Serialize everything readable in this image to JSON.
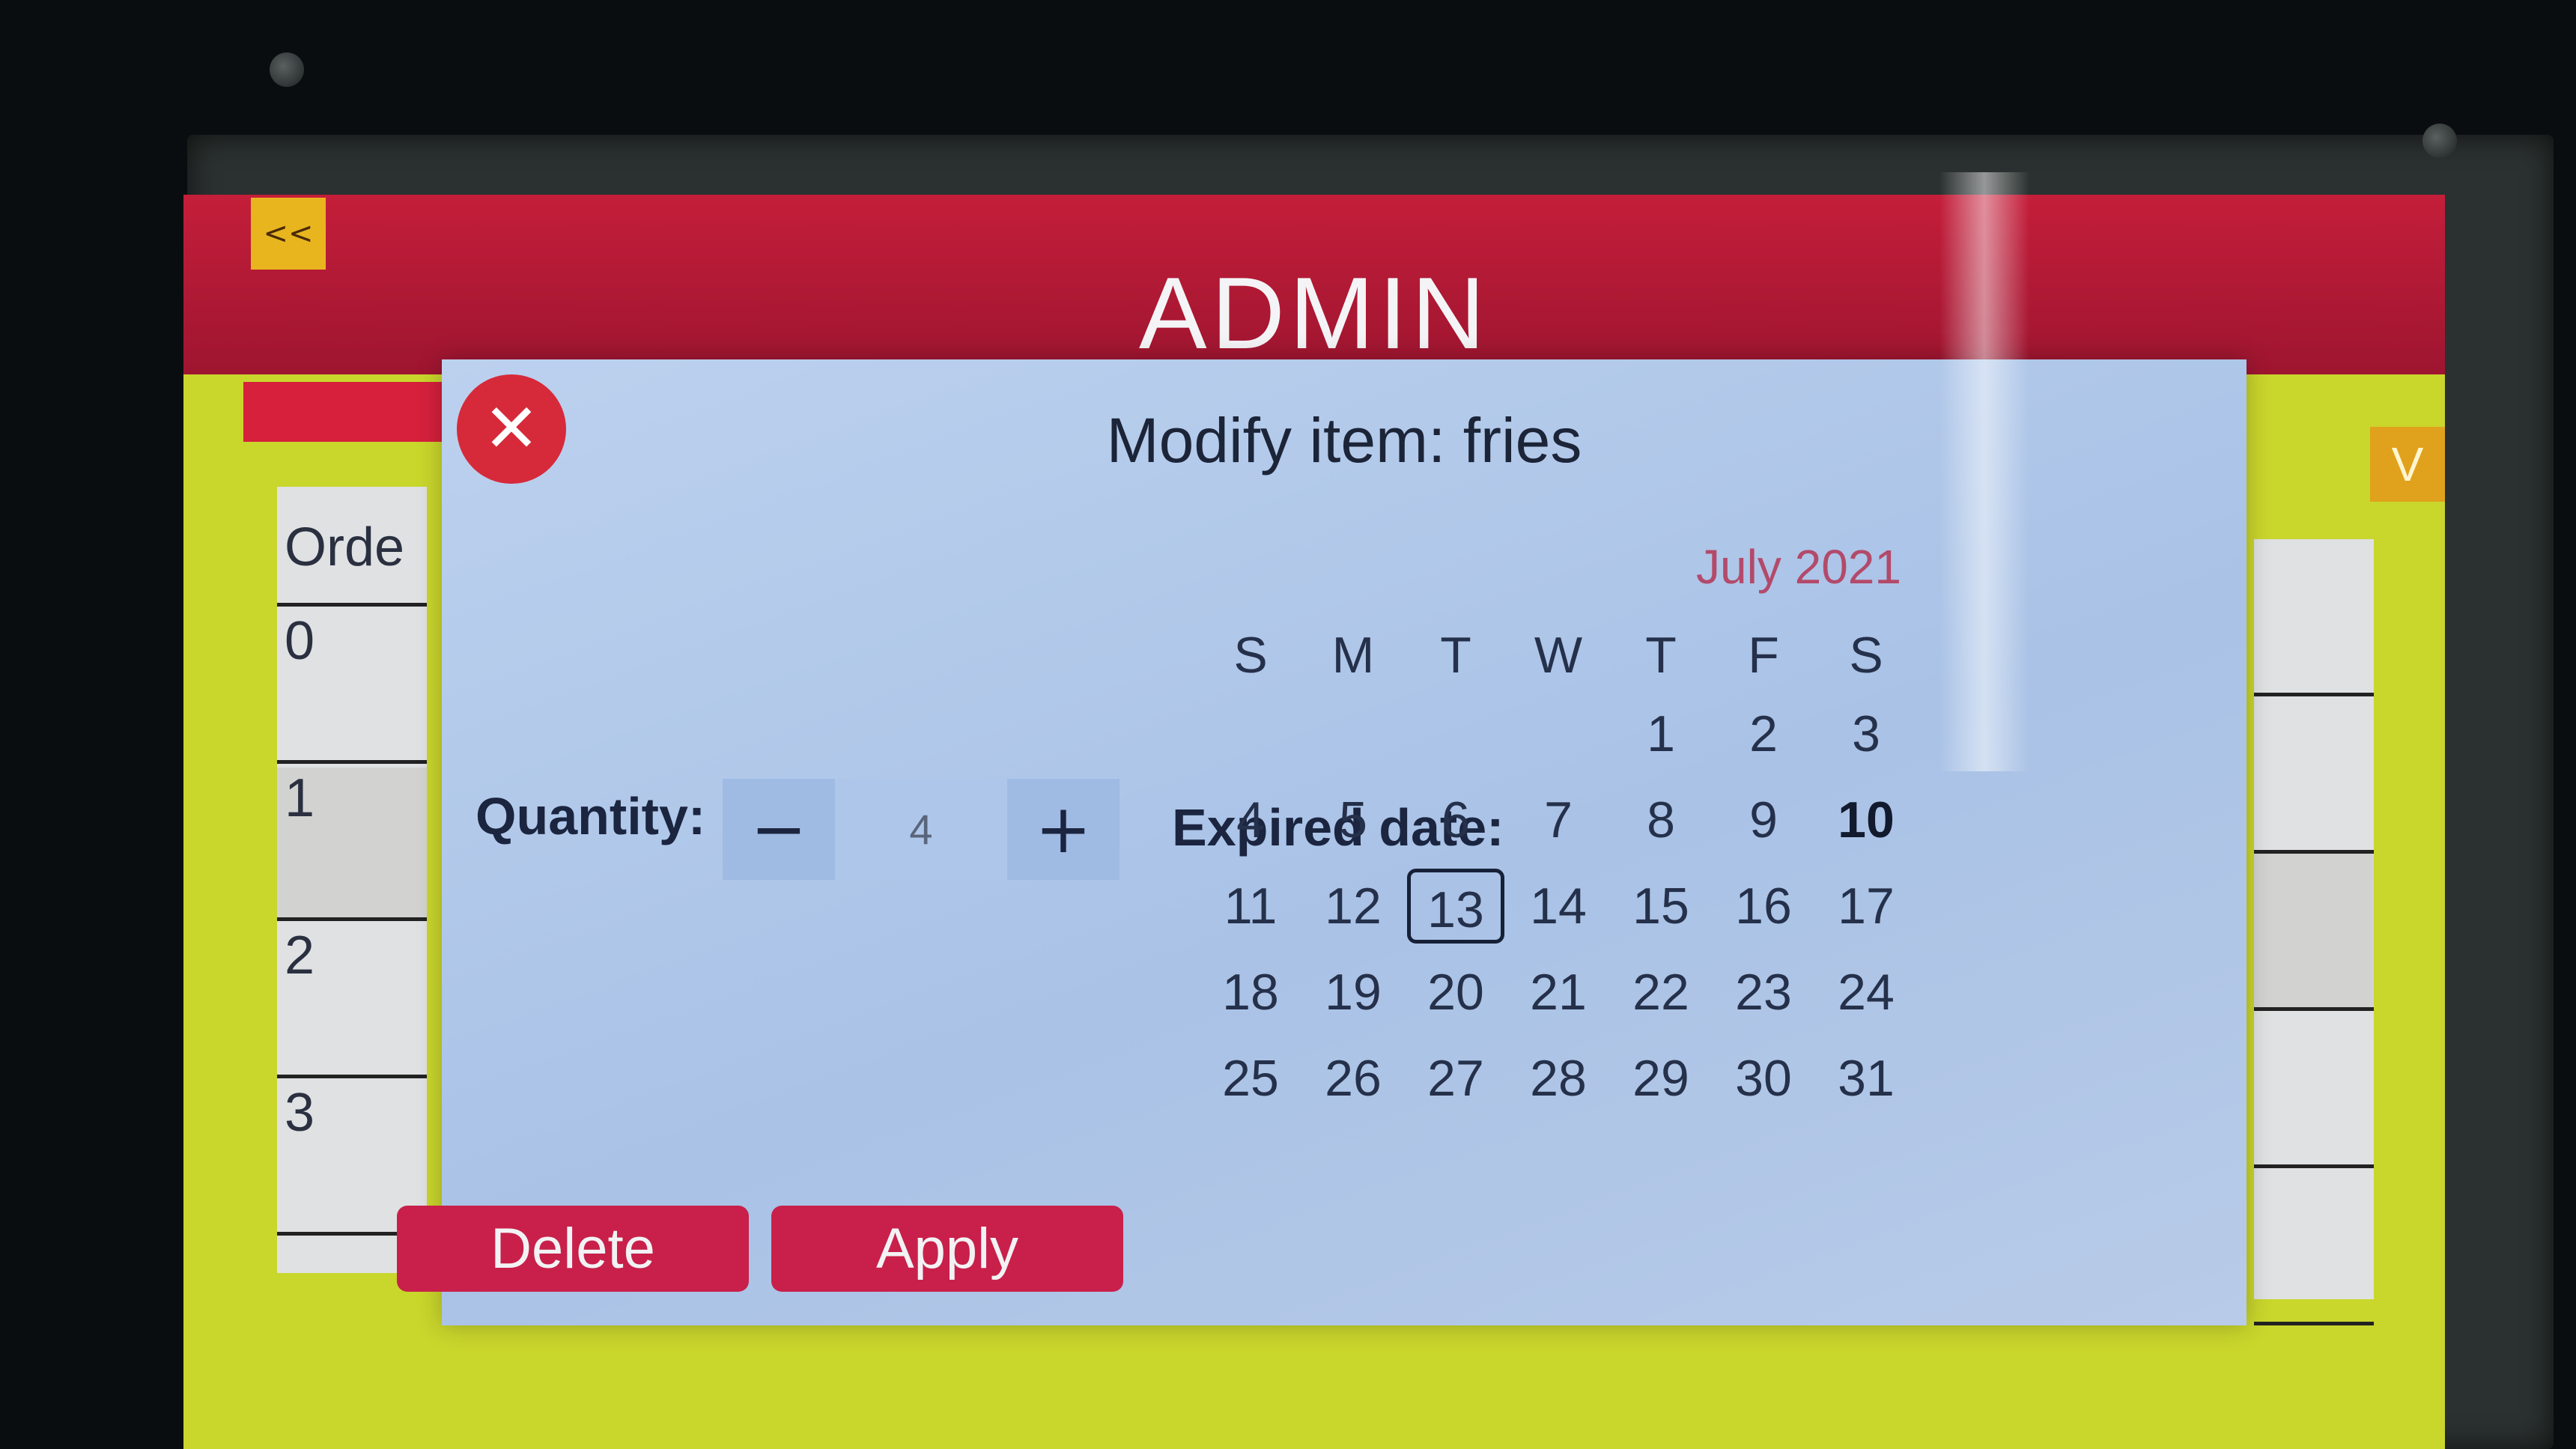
{
  "header": {
    "back_label": "<<",
    "title": "ADMIN",
    "dropdown_label": "V"
  },
  "background_table": {
    "header_fragment": "Orde",
    "rows": [
      "0",
      "1",
      "2",
      "3"
    ]
  },
  "modal": {
    "title": "Modify item: fries",
    "quantity_label": "Quantity:",
    "quantity_minus": "−",
    "quantity_value": "4",
    "quantity_plus": "+",
    "expired_label": "Expired date:",
    "delete_label": "Delete",
    "apply_label": "Apply"
  },
  "calendar": {
    "month_label": "July 2021",
    "weekdays": [
      "S",
      "M",
      "T",
      "W",
      "T",
      "F",
      "S"
    ],
    "weeks": [
      [
        "",
        "",
        "",
        "",
        "1",
        "2",
        "3"
      ],
      [
        "4",
        "5",
        "6",
        "7",
        "8",
        "9",
        "10"
      ],
      [
        "11",
        "12",
        "13",
        "14",
        "15",
        "16",
        "17"
      ],
      [
        "18",
        "19",
        "20",
        "21",
        "22",
        "23",
        "24"
      ],
      [
        "25",
        "26",
        "27",
        "28",
        "29",
        "30",
        "31"
      ]
    ],
    "today": "10",
    "selected": "13"
  },
  "colors": {
    "header_red": "#c41e3a",
    "screen_yellow": "#c9d62c",
    "modal_blue": "#bcd1ee",
    "button_red": "#c8204a",
    "back_amber": "#e8b51f"
  }
}
